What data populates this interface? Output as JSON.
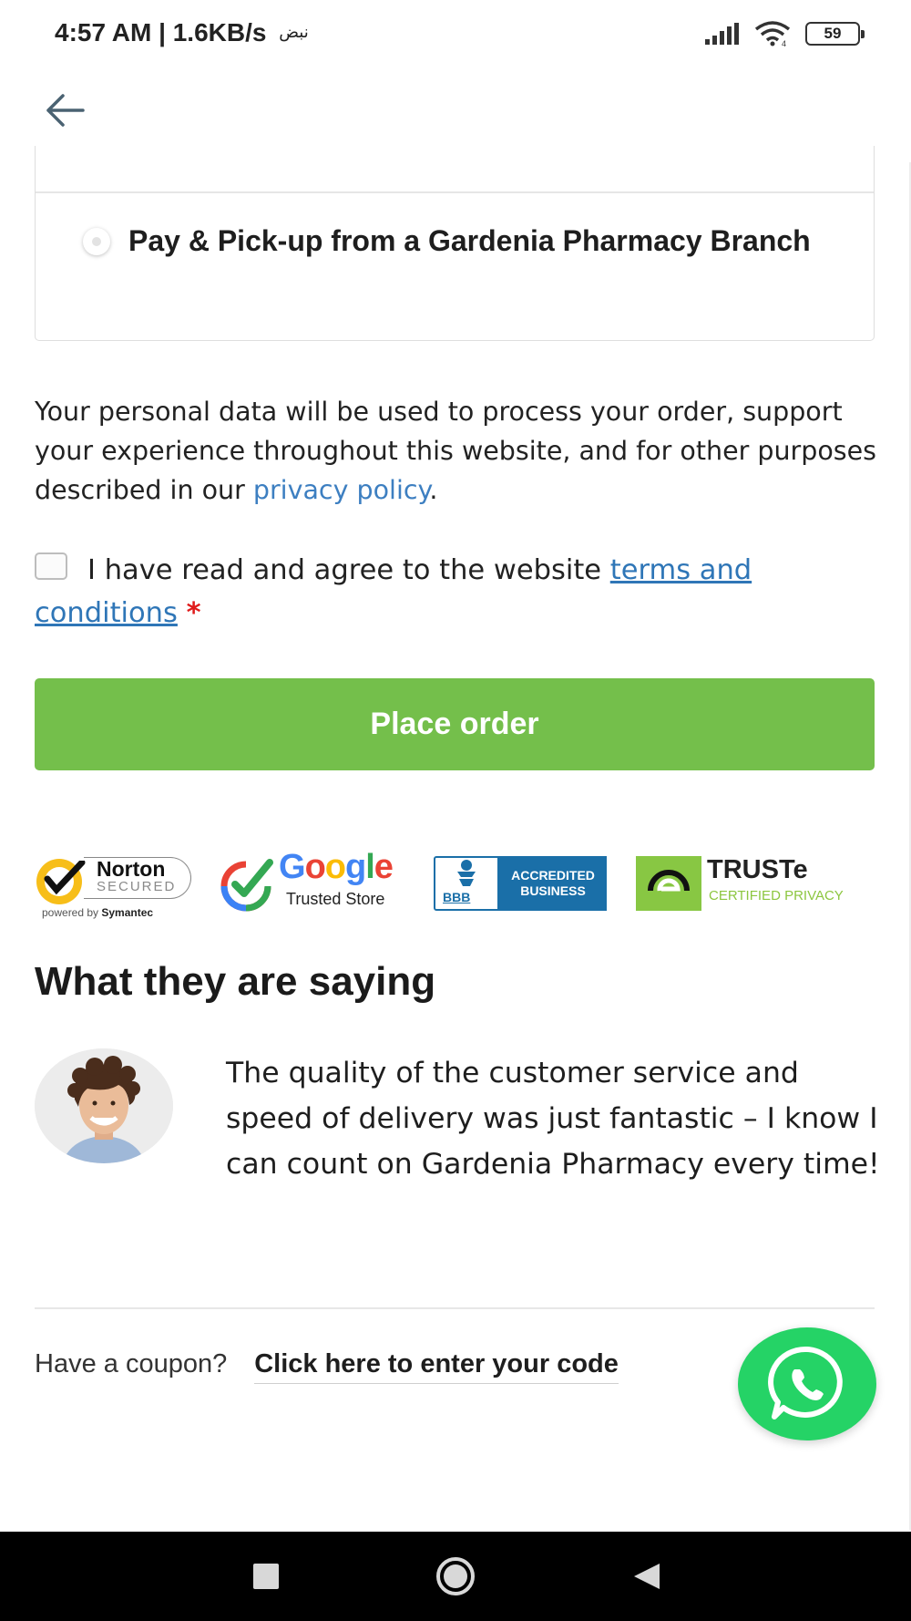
{
  "status_bar": {
    "time": "4:57 AM",
    "speed": "| 1.6KB/s",
    "carrier_text": "نبض",
    "battery": "59"
  },
  "payment": {
    "option_label": "Pay & Pick-up from a Gardenia Pharmacy Branch"
  },
  "privacy": {
    "text_before": "Your personal data will be used to process your order, support your experience throughout this website, and for other purposes described in our ",
    "link": "privacy policy",
    "text_after": "."
  },
  "terms": {
    "text": "I have read and agree to the website ",
    "link": "terms and conditions",
    "required_mark": "*"
  },
  "checkout": {
    "place_order_label": "Place order"
  },
  "badges": {
    "norton": {
      "name": "Norton",
      "secured": "SECURED",
      "powered_prefix": "powered by ",
      "powered_brand": "Symantec"
    },
    "google": {
      "word": "Google",
      "sub": "Trusted Store"
    },
    "bbb": {
      "text": "ACCREDITED BUSINESS",
      "mark": "BBB"
    },
    "truste": {
      "name": "TRUSTe",
      "sub": "CERTIFIED PRIVACY"
    }
  },
  "testimonial": {
    "heading": "What they are saying",
    "quote": "The quality of the customer service and speed of delivery was just fantastic – I know I can count on Gardenia Pharmacy every time!"
  },
  "coupon": {
    "prompt": "Have a coupon?",
    "link": "Click here to enter your code"
  },
  "icons": {
    "back": "arrow-left-icon",
    "whatsapp": "whatsapp-icon",
    "nav_recents": "square-icon",
    "nav_home": "circle-icon",
    "nav_back": "triangle-icon"
  },
  "colors": {
    "accent_green": "#74bf4b",
    "link_blue": "#3d7fc1",
    "required_red": "#e01b1b",
    "whatsapp_green": "#25d366"
  }
}
